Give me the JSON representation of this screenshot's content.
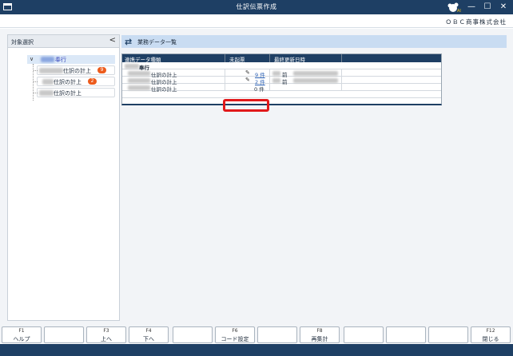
{
  "titlebar": {
    "title": "仕訳伝票作成",
    "minimize_glyph": "—",
    "maximize_glyph": "☐",
    "close_glyph": "✕",
    "brand_icon": "obc-bugyo-logo-icon"
  },
  "company": {
    "name": "ＯＢＣ商事株式会社"
  },
  "left_panel": {
    "title": "対象選択",
    "collapse_glyph": "<",
    "root": {
      "label": "奉行",
      "expanded": true
    },
    "items": [
      {
        "label": "仕訳の計上",
        "badge": "9"
      },
      {
        "label": "仕訳の計上",
        "badge": "2"
      },
      {
        "label": "仕訳の計上",
        "badge": ""
      }
    ]
  },
  "right_panel": {
    "title": "業務データ一覧",
    "refresh_icon": "refresh-icon",
    "table": {
      "columns": [
        "連携データ種類",
        "未起票",
        "最終更新日時"
      ],
      "group_label": "奉行",
      "rows": [
        {
          "type": "仕訳の計上",
          "count": "9 件",
          "count_is_link": true,
          "updated_suffix": "前"
        },
        {
          "type": "仕訳の計上",
          "count": "2 件",
          "count_is_link": true,
          "updated_suffix": "前"
        },
        {
          "type": "仕訳の計上",
          "count": "0 件",
          "count_is_link": false,
          "updated_suffix": ""
        }
      ]
    }
  },
  "function_keys": [
    {
      "key": "F1",
      "label": "ヘルプ"
    },
    {
      "key": "",
      "label": ""
    },
    {
      "key": "F3",
      "label": "上へ"
    },
    {
      "key": "F4",
      "label": "下へ"
    },
    {
      "key": "",
      "label": ""
    },
    {
      "key": "F6",
      "label": "コード設定"
    },
    {
      "key": "",
      "label": ""
    },
    {
      "key": "F8",
      "label": "再集計"
    },
    {
      "key": "",
      "label": ""
    },
    {
      "key": "",
      "label": ""
    },
    {
      "key": "",
      "label": ""
    },
    {
      "key": "F12",
      "label": "閉じる"
    }
  ],
  "colors": {
    "title_bar": "#1e3f64",
    "badge": "#ec5b1c",
    "highlight": "#e1191b",
    "link": "#2a5fb3"
  }
}
